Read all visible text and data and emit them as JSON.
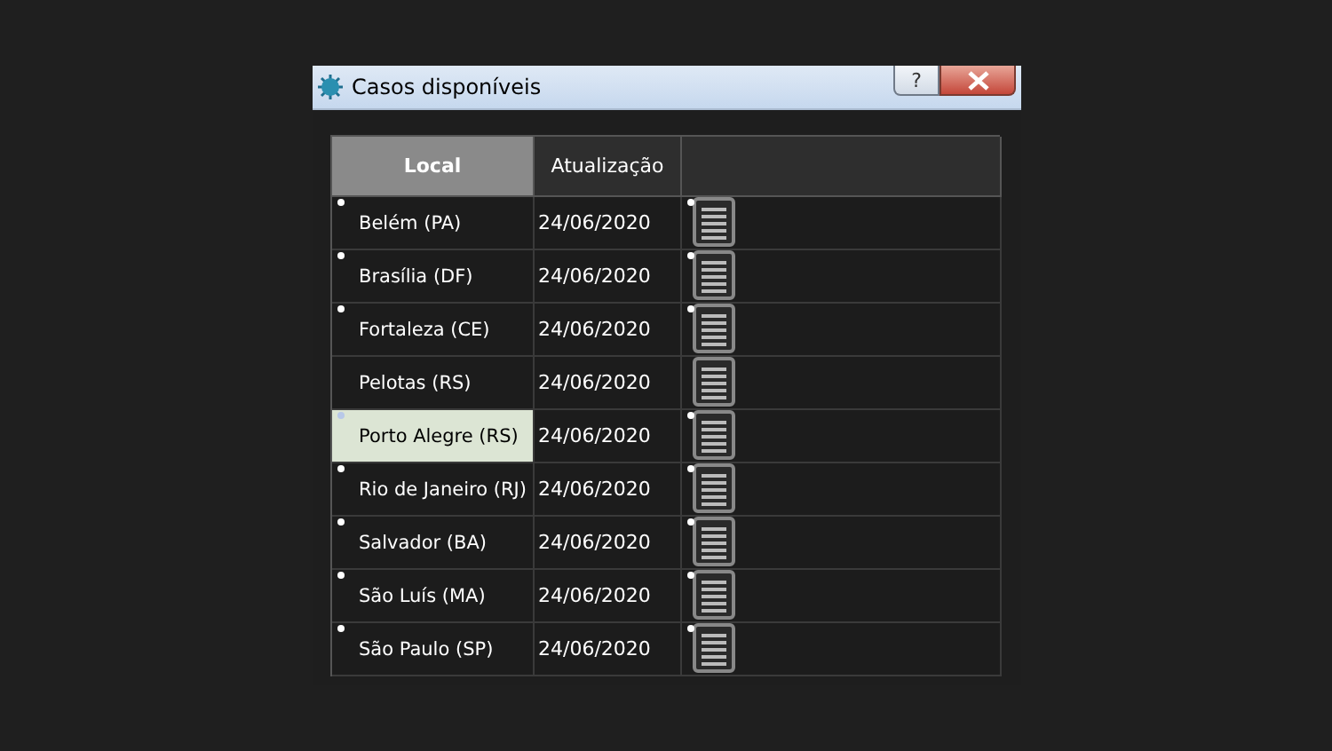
{
  "window": {
    "title": "Casos disponíveis",
    "buttons": [
      "?"
    ]
  },
  "table": {
    "columns": [
      {
        "label": "Local",
        "selected": true
      },
      {
        "label": "Atualização",
        "selected": false
      }
    ],
    "rows": [
      {
        "local": "Belém (PA)",
        "date": "24/06/2020",
        "marked": true,
        "selected": false
      },
      {
        "local": "Brasília (DF)",
        "date": "24/06/2020",
        "marked": true,
        "selected": false
      },
      {
        "local": "Fortaleza (CE)",
        "date": "24/06/2020",
        "marked": true,
        "selected": false
      },
      {
        "local": "Pelotas (RS)",
        "date": "24/06/2020",
        "marked": false,
        "selected": false
      },
      {
        "local": "Porto Alegre (RS)",
        "date": "24/06/2020",
        "marked": true,
        "selected": true
      },
      {
        "local": "Rio de Janeiro (RJ)",
        "date": "24/06/2020",
        "marked": true,
        "selected": false
      },
      {
        "local": "Salvador (BA)",
        "date": "24/06/2020",
        "marked": true,
        "selected": false
      },
      {
        "local": "São Luís (MA)",
        "date": "24/06/2020",
        "marked": true,
        "selected": false
      },
      {
        "local": "São Paulo (SP)",
        "date": "24/06/2020",
        "marked": true,
        "selected": false
      }
    ]
  }
}
